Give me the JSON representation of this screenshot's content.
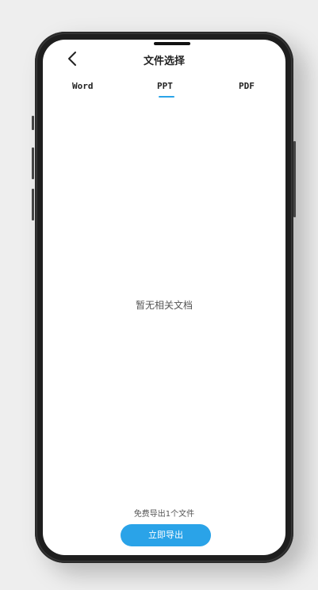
{
  "header": {
    "back_icon": "chevron-left-icon",
    "title": "文件选择"
  },
  "tabs": [
    {
      "label": "Word",
      "selected": false
    },
    {
      "label": "PPT",
      "selected": true
    },
    {
      "label": "PDF",
      "selected": false
    }
  ],
  "main": {
    "empty_text": "暂无相关文档"
  },
  "footer": {
    "free_note": "免费导出1个文件",
    "export_label": "立即导出"
  },
  "colors": {
    "accent": "#2aa3e8",
    "text": "#222222",
    "muted": "#555555",
    "background": "#ffffff"
  }
}
